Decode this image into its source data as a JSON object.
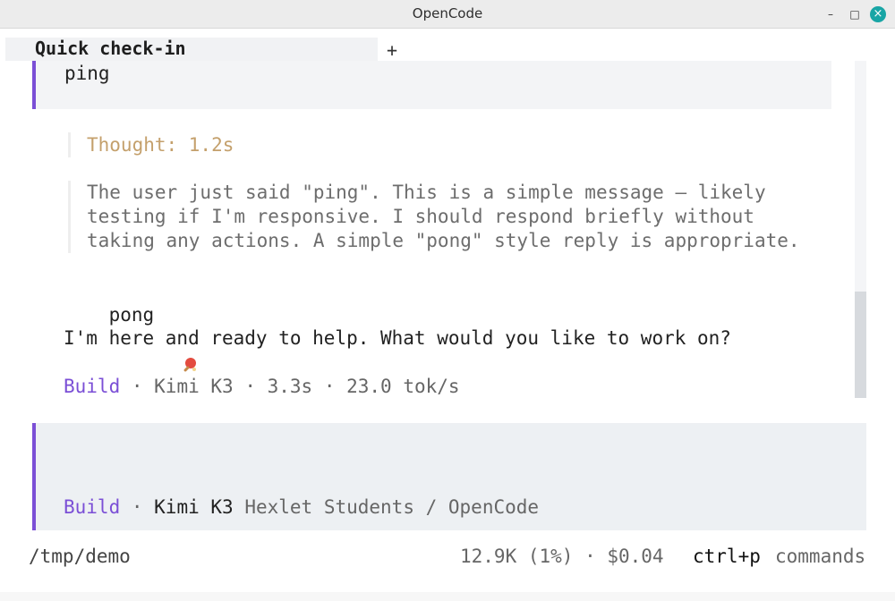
{
  "window": {
    "title": "OpenCode",
    "minimize": "–",
    "maximize": "□",
    "close": "×"
  },
  "tabs": {
    "active_label": "Quick check-in",
    "add_label": "+"
  },
  "chat": {
    "user_message": "ping",
    "thought_label": "Thought: 1.2s",
    "thought_lines": [
      "The user just said \"ping\". This is a simple message — likely",
      "testing if I'm responsive. I should respond briefly without",
      "taking any actions. A simple \"pong\" style reply is appropriate."
    ],
    "reply_line_1": "pong",
    "reply_line_2": "I'm here and ready to help. What would you like to work on?",
    "meta": {
      "agent": "Build",
      "sep1": " · ",
      "model": "Kimi K3",
      "sep2": " · ",
      "duration": "3.3s",
      "sep3": " · ",
      "speed": "23.0 tok/s"
    }
  },
  "input": {
    "value": "",
    "agent": "Build",
    "sep": " · ",
    "model": "Kimi K3",
    "context": " Hexlet Students / OpenCode"
  },
  "status": {
    "path": "/tmp/demo",
    "usage": "12.9K (1%) · $0.04",
    "shortcut": "ctrl+p",
    "shortcut_label": "commands"
  },
  "icons": {
    "paddle": "ping-pong-paddle-icon"
  },
  "colors": {
    "accent": "#7b4fd6",
    "thought": "#c4a06c",
    "close_button": "#18a5a5"
  }
}
